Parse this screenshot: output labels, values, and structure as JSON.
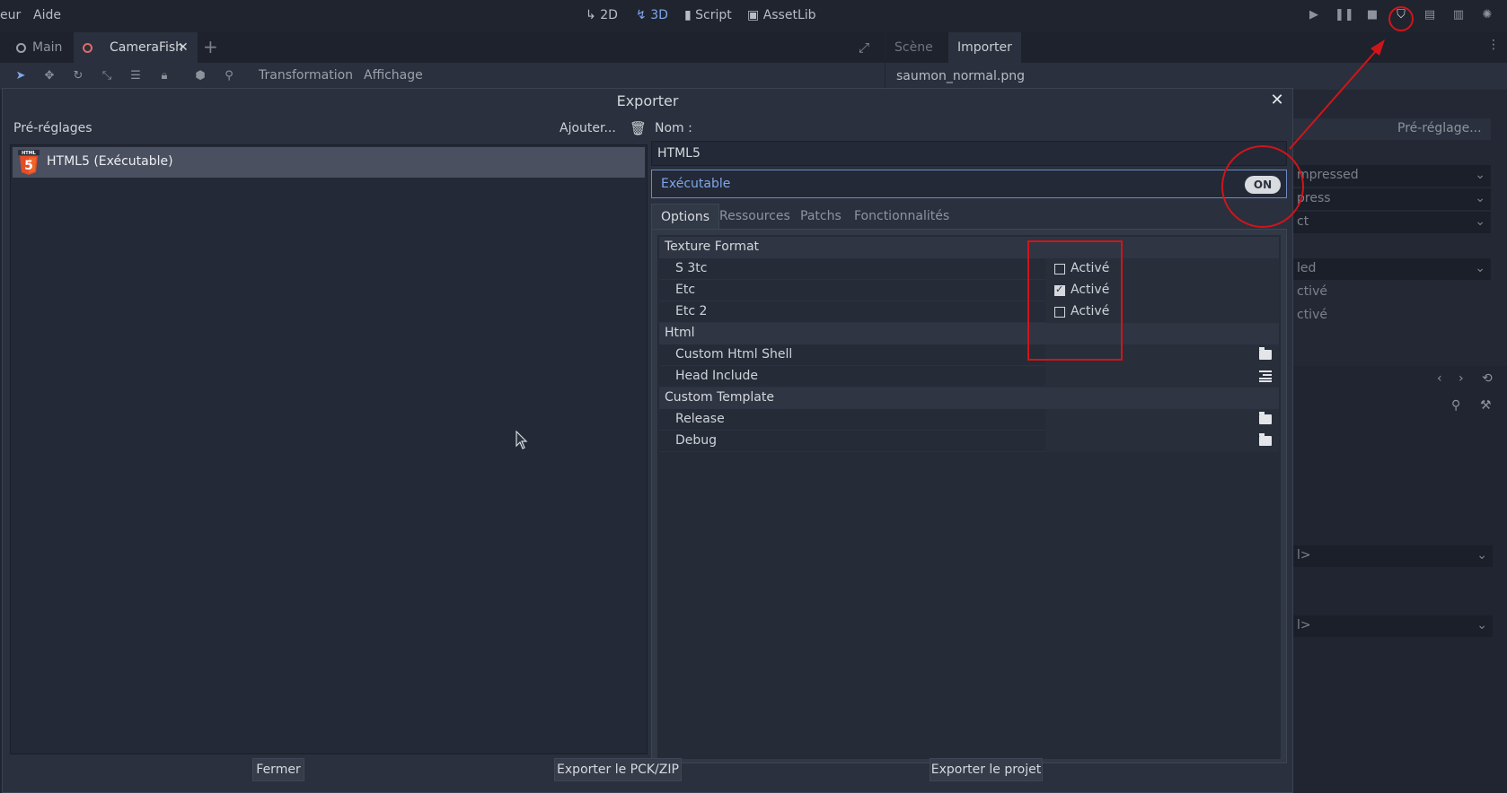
{
  "topbar": {
    "menu_partial": "eur",
    "menu_help": "Aide",
    "workspaces": [
      {
        "name": "2d-workspace",
        "icon": "↳",
        "label": "2D"
      },
      {
        "name": "3d-workspace",
        "icon": "↯",
        "label": "3D"
      },
      {
        "name": "script-workspace",
        "icon": "▮",
        "label": "Script"
      },
      {
        "name": "assetlib-workspace",
        "icon": "▣",
        "label": "AssetLib"
      }
    ]
  },
  "scene_tabs": {
    "tab_main": "Main",
    "tab_camera": "CameraFish",
    "close": "✕",
    "add": "+"
  },
  "scene_toolbar": {
    "menu_transform": "Transformation",
    "menu_view": "Affichage"
  },
  "right_panel": {
    "tab_scene": "Scène",
    "tab_import": "Importer",
    "file": "saumon_normal.png",
    "preset_menu": "Pré-réglage...",
    "fragments": [
      "mpressed",
      "press",
      "ct",
      "led",
      "ctivé",
      "ctivé",
      "l>",
      "l>"
    ]
  },
  "dialog": {
    "title": "Exporter",
    "close": "✕",
    "presets_label": "Pré-réglages",
    "add_button": "Ajouter...",
    "name_label": "Nom :",
    "preset_item": "HTML5 (Exécutable)",
    "preset_logo_text": "HTML",
    "preset_logo_number": "5",
    "name_value": "HTML5",
    "runnable_label": "Exécutable",
    "runnable_toggle": "ON",
    "tabs": [
      "Options",
      "Ressources",
      "Patchs",
      "Fonctionnalités"
    ],
    "sections": {
      "texture_format": "Texture Format",
      "html": "Html",
      "custom_template": "Custom Template"
    },
    "props": {
      "s3tc": "S 3tc",
      "etc": "Etc",
      "etc2": "Etc 2",
      "custom_html_shell": "Custom Html Shell",
      "head_include": "Head Include",
      "release": "Release",
      "debug": "Debug"
    },
    "checkbox_label": "Activé",
    "checkbox_states": {
      "s3tc": false,
      "etc": true,
      "etc2": false
    },
    "buttons": {
      "close": "Fermer",
      "export_pck": "Exporter le PCK/ZIP",
      "export_project": "Exporter le projet"
    }
  },
  "colors": {
    "bg": "#202531",
    "panel": "#2a303d",
    "accent": "#7fa6ec",
    "annotation": "#d0151a"
  }
}
